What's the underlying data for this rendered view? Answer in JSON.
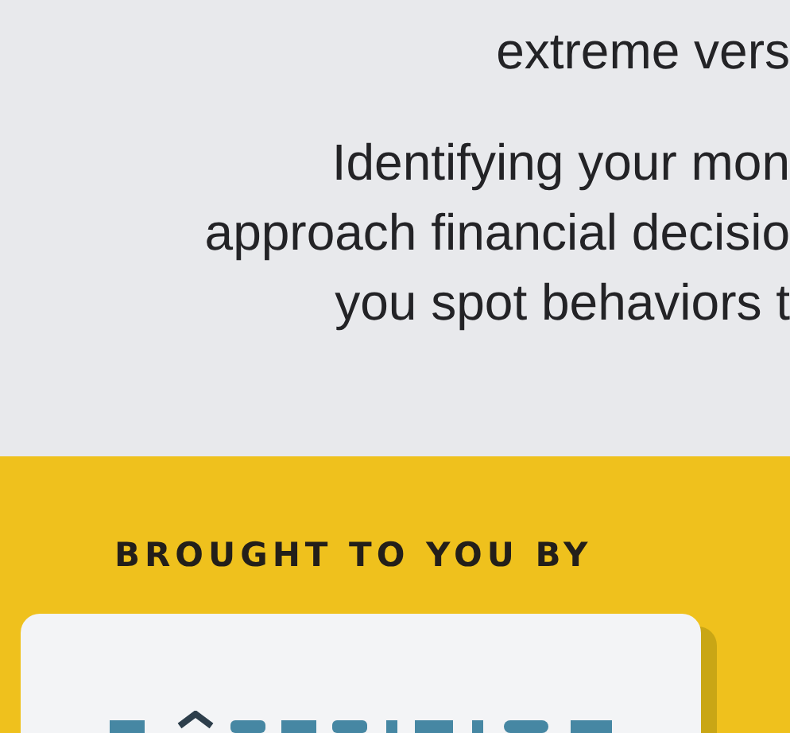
{
  "intro": {
    "line": "extreme vers"
  },
  "paragraph": {
    "lines": [
      "Identifying your mon",
      "approach financial decisio",
      "you spot behaviors t"
    ]
  },
  "sponsor": {
    "heading": "BROUGHT TO YOU BY"
  }
}
